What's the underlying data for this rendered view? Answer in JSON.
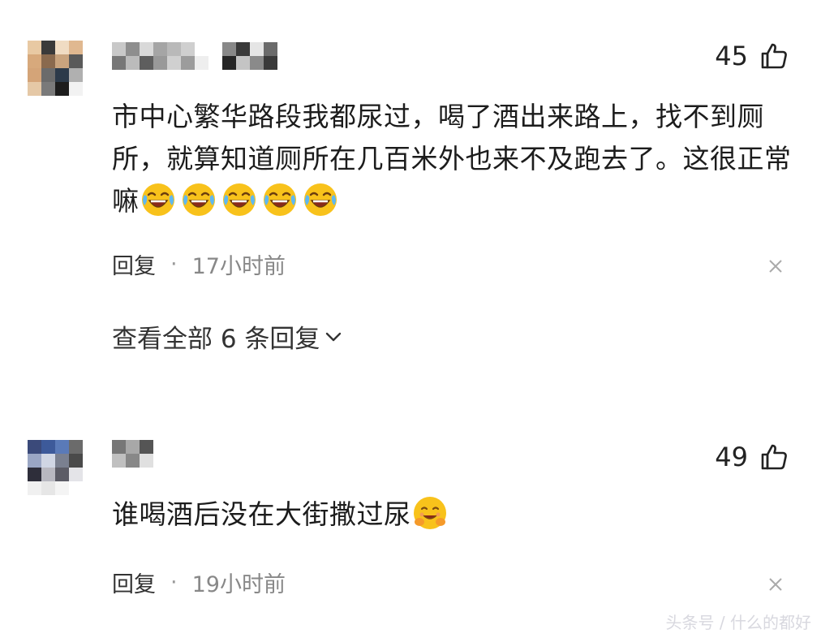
{
  "comments": [
    {
      "likes": "45",
      "text": "市中心繁华路段我都尿过，喝了酒出来路上，找不到厕所，就算知道厕所在几百米外也来不及跑去了。这很正常嘛",
      "emoji_name": "laughing-crying-emoji",
      "emoji_count": 5,
      "reply_label": "回复",
      "separator": "·",
      "time": "17小时前",
      "view_all_replies": "查看全部 6 条回复"
    },
    {
      "likes": "49",
      "text": "谁喝酒后没在大街撒过尿",
      "emoji_name": "hugging-face-emoji",
      "reply_label": "回复",
      "separator": "·",
      "time": "19小时前"
    }
  ],
  "watermark": "头条号 / 什么的都好",
  "icons": {
    "like": "thumbs-up-icon",
    "close": "close-icon",
    "expand": "chevron-down-icon"
  },
  "colors": {
    "text": "#1c1c1c",
    "meta": "#888888",
    "emoji_yellow": "#f8c21b"
  }
}
